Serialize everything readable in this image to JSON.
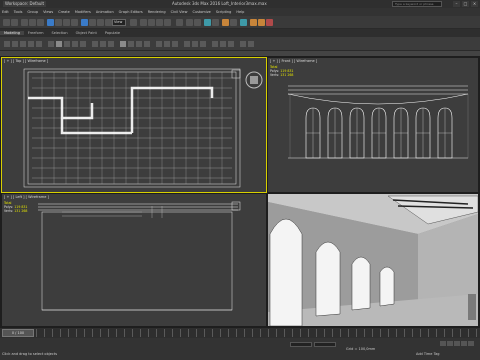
{
  "app": {
    "workspace": "Workspace: Default",
    "title": "Autodesk 3ds Max 2016     Loft_Interior3max.max",
    "search_placeholder": "Type a keyword or phrase",
    "min_label": "–",
    "max_label": "□",
    "close_label": "×"
  },
  "menu": [
    "Edit",
    "Tools",
    "Group",
    "Views",
    "Create",
    "Modifiers",
    "Animation",
    "Graph Editors",
    "Rendering",
    "Civil View",
    "Customize",
    "Scripting",
    "Help"
  ],
  "toolbar": {
    "view_selector": "View"
  },
  "ribbon": {
    "tabs": [
      "Modeling",
      "Freeform",
      "Selection",
      "Object Paint",
      "Populate"
    ],
    "active": "Modeling"
  },
  "viewports": {
    "top": {
      "label": "[ + ] [ Top ] [ Wireframe ]"
    },
    "front": {
      "label": "[ + ] [ Front ] [ Wireframe ]",
      "stats": {
        "title": "Total",
        "polys_label": "Polys:",
        "polys": "119 831",
        "verts_label": "Verts:",
        "verts": "131 268"
      }
    },
    "left": {
      "label": "[ + ] [ Left ] [ Wireframe ]",
      "stats": {
        "title": "Total",
        "polys_label": "Polys:",
        "polys": "119 831",
        "verts_label": "Verts:",
        "verts": "131 268"
      }
    },
    "persp": {
      "label": "[ + ] [ Perspective ] [ Shaded ]"
    }
  },
  "timeline": {
    "slider": "0 / 100"
  },
  "status": {
    "message": "Click and drag to select objects",
    "grid": "Grid = 100,0mm",
    "add_time_tag": "Add Time Tag"
  }
}
